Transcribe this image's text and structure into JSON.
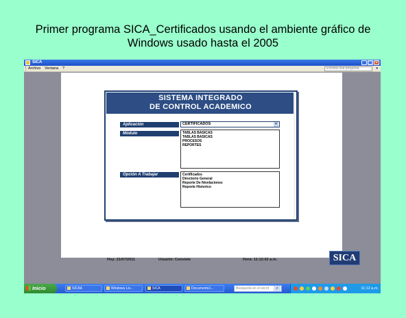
{
  "slide": {
    "title_line1": "Primer programa SICA_Certificados usando el ambiente gráfico de",
    "title_line2": "Windows usado hasta el 2005"
  },
  "window": {
    "title": "SICA",
    "controls": {
      "minimize": "_",
      "maximize": "□",
      "close": "✕"
    }
  },
  "menu": {
    "items": [
      "Archivo",
      "Ventana",
      "?"
    ],
    "help_placeholder": "Escriba una pregunta",
    "help_arrow": "▾"
  },
  "form": {
    "title_line1": "SISTEMA INTEGRADO",
    "title_line2": "DE CONTROL ACADEMICO",
    "aplicacion_label": "Aplicación",
    "aplicacion_value": "CERTIFICADOS",
    "modulo_label": "Módulo",
    "modulo_items": [
      "TABLAS BASICAS",
      "TABLAS BASICAS",
      "PROCESOS",
      "REPORTES"
    ],
    "opcion_label": "Opción A Trabajar",
    "opcion_items": [
      "Certificados",
      "Directorio General",
      "Reporte De Nivelaciones",
      "Reporte Historico"
    ]
  },
  "status": {
    "hoy": "Hoy: 21/07/2011",
    "usuario": "Usuario: Consiste",
    "hora": "Hora: 11:12:02 a.m."
  },
  "logo_text": "SICA",
  "taskbar": {
    "start_label": "Inicio",
    "tasks": [
      "SICAA",
      "Windows Liv...",
      "SICA",
      "Documento1..."
    ],
    "search_placeholder": "Búsqueda en el escrit",
    "search_icon": "⌕",
    "clock": "11:12 a.m."
  },
  "colors": {
    "slide_bg": "#99ffcc",
    "form_header": "#2d4d84",
    "label_bg": "#1f3f70",
    "taskbar": "#2458d0",
    "start_green": "#2f8a2f"
  }
}
